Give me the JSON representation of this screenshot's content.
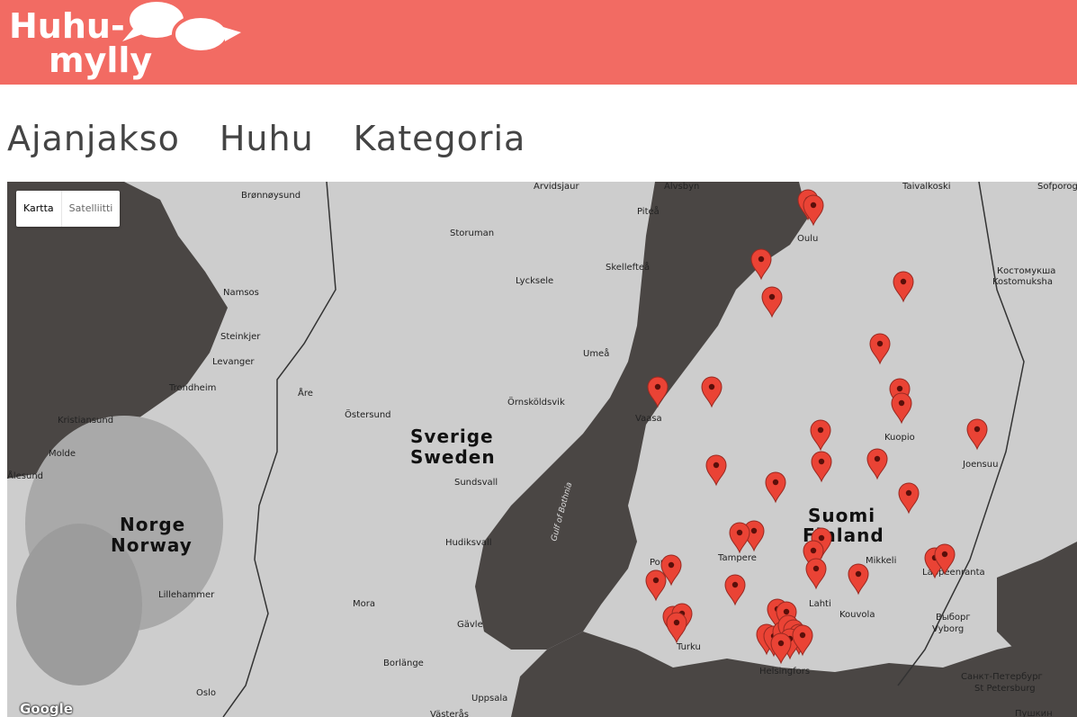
{
  "logo": {
    "line1": "Huhu-",
    "line2": "mylly"
  },
  "nav": {
    "tabs": [
      "Ajanjakso",
      "Huhu",
      "Kategoria"
    ]
  },
  "map": {
    "type_control": {
      "map_label": "Kartta",
      "satellite_label": "Satelliitti",
      "selected": "Kartta"
    },
    "attribution": "Google",
    "countries": [
      {
        "l1": "Sverige",
        "l2": "Sweden"
      },
      {
        "l1": "Norge",
        "l2": "Norway"
      },
      {
        "l1": "Suomi",
        "l2": "Finland"
      }
    ],
    "water_label": "Gulf of Bothnia",
    "places": [
      "Brønnøysund",
      "Arvidsjaur",
      "Taivalkoski",
      "Sofporog",
      "Älvsbyn",
      "Piteå",
      "Storuman",
      "Oulu",
      "Kostomuksha",
      "Костомукша",
      "Namsos",
      "Lycksele",
      "Skellefteå",
      "Steinkjer",
      "Levanger",
      "Umeå",
      "Trondheim",
      "Åre",
      "Kristiansund",
      "Östersund",
      "Örnsköldsvik",
      "Vaasa",
      "Kuopio",
      "Molde",
      "Ålesund",
      "Joensuu",
      "Sundsvall",
      "Hudiksvall",
      "Pori",
      "Tampere",
      "Mikkeli",
      "Lappeenranta",
      "Lahti",
      "Lillehammer",
      "Mora",
      "Kouvola",
      "Выборг",
      "Vyborg",
      "Turku",
      "Gävle",
      "Borlänge",
      "Helsingfors",
      "Санкт-Петербург",
      "St Petersburg",
      "Oslo",
      "Uppsala",
      "Västerås",
      "Пушкин"
    ],
    "marker_color": "#ea4335"
  }
}
